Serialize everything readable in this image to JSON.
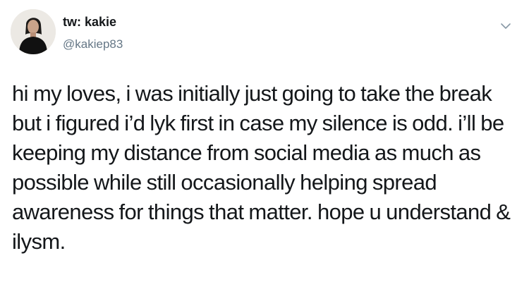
{
  "user": {
    "display_name": "tw: kakie",
    "handle": "@kakiep83",
    "avatar_icon": "profile-photo-icon"
  },
  "menu": {
    "icon": "chevron-down-icon"
  },
  "tweet": {
    "lines": [
      "hi my loves, i was initially just going to take the break",
      "but i figured i’d lyk first in case my silence is odd. i’ll be",
      "keeping my distance from social media as much as",
      "possible while still occasionally helping spread",
      "awareness for things that matter. hope u understand &",
      "ilysm."
    ]
  },
  "colors": {
    "text": "#14171a",
    "secondary_text": "#657786",
    "icon": "#8899a6",
    "background": "#ffffff"
  }
}
